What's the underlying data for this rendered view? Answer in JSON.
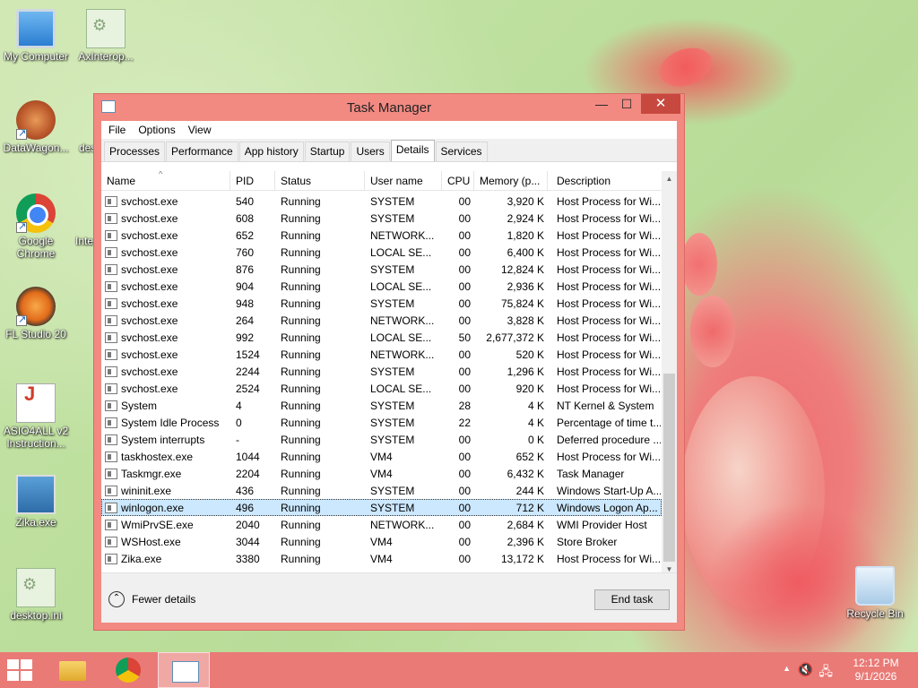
{
  "desktop": {
    "icons": [
      {
        "label": "My Computer"
      },
      {
        "label": "AxInterop..."
      },
      {
        "label": "DataWagon..."
      },
      {
        "label": "des"
      },
      {
        "label": "Google Chrome"
      },
      {
        "label": "Inte"
      },
      {
        "label": "FL Studio 20"
      },
      {
        "label": "ASIO4ALL v2 Instruction..."
      },
      {
        "label": "Zika.exe"
      },
      {
        "label": "desktop.ini"
      },
      {
        "label": "Recycle Bin"
      }
    ]
  },
  "window": {
    "title": "Task Manager",
    "controls": {
      "minimize": "—",
      "maximize": "☐",
      "close": "✕"
    },
    "menu": [
      "File",
      "Options",
      "View"
    ],
    "tabs": [
      "Processes",
      "Performance",
      "App history",
      "Startup",
      "Users",
      "Details",
      "Services"
    ],
    "active_tab": "Details",
    "columns": [
      "Name",
      "PID",
      "Status",
      "User name",
      "CPU",
      "Memory (p...",
      "Description"
    ],
    "rows": [
      {
        "name": "svchost.exe",
        "pid": "540",
        "status": "Running",
        "user": "SYSTEM",
        "cpu": "00",
        "mem": "3,920 K",
        "desc": "Host Process for Wi..."
      },
      {
        "name": "svchost.exe",
        "pid": "608",
        "status": "Running",
        "user": "SYSTEM",
        "cpu": "00",
        "mem": "2,924 K",
        "desc": "Host Process for Wi..."
      },
      {
        "name": "svchost.exe",
        "pid": "652",
        "status": "Running",
        "user": "NETWORK...",
        "cpu": "00",
        "mem": "1,820 K",
        "desc": "Host Process for Wi..."
      },
      {
        "name": "svchost.exe",
        "pid": "760",
        "status": "Running",
        "user": "LOCAL SE...",
        "cpu": "00",
        "mem": "6,400 K",
        "desc": "Host Process for Wi..."
      },
      {
        "name": "svchost.exe",
        "pid": "876",
        "status": "Running",
        "user": "SYSTEM",
        "cpu": "00",
        "mem": "12,824 K",
        "desc": "Host Process for Wi..."
      },
      {
        "name": "svchost.exe",
        "pid": "904",
        "status": "Running",
        "user": "LOCAL SE...",
        "cpu": "00",
        "mem": "2,936 K",
        "desc": "Host Process for Wi..."
      },
      {
        "name": "svchost.exe",
        "pid": "948",
        "status": "Running",
        "user": "SYSTEM",
        "cpu": "00",
        "mem": "75,824 K",
        "desc": "Host Process for Wi..."
      },
      {
        "name": "svchost.exe",
        "pid": "264",
        "status": "Running",
        "user": "NETWORK...",
        "cpu": "00",
        "mem": "3,828 K",
        "desc": "Host Process for Wi..."
      },
      {
        "name": "svchost.exe",
        "pid": "992",
        "status": "Running",
        "user": "LOCAL SE...",
        "cpu": "50",
        "mem": "2,677,372 K",
        "desc": "Host Process for Wi..."
      },
      {
        "name": "svchost.exe",
        "pid": "1524",
        "status": "Running",
        "user": "NETWORK...",
        "cpu": "00",
        "mem": "520 K",
        "desc": "Host Process for Wi..."
      },
      {
        "name": "svchost.exe",
        "pid": "2244",
        "status": "Running",
        "user": "SYSTEM",
        "cpu": "00",
        "mem": "1,296 K",
        "desc": "Host Process for Wi..."
      },
      {
        "name": "svchost.exe",
        "pid": "2524",
        "status": "Running",
        "user": "LOCAL SE...",
        "cpu": "00",
        "mem": "920 K",
        "desc": "Host Process for Wi..."
      },
      {
        "name": "System",
        "pid": "4",
        "status": "Running",
        "user": "SYSTEM",
        "cpu": "28",
        "mem": "4 K",
        "desc": "NT Kernel & System"
      },
      {
        "name": "System Idle Process",
        "pid": "0",
        "status": "Running",
        "user": "SYSTEM",
        "cpu": "22",
        "mem": "4 K",
        "desc": "Percentage of time t..."
      },
      {
        "name": "System interrupts",
        "pid": "-",
        "status": "Running",
        "user": "SYSTEM",
        "cpu": "00",
        "mem": "0 K",
        "desc": "Deferred procedure ..."
      },
      {
        "name": "taskhostex.exe",
        "pid": "1044",
        "status": "Running",
        "user": "VM4",
        "cpu": "00",
        "mem": "652 K",
        "desc": "Host Process for Wi..."
      },
      {
        "name": "Taskmgr.exe",
        "pid": "2204",
        "status": "Running",
        "user": "VM4",
        "cpu": "00",
        "mem": "6,432 K",
        "desc": "Task Manager"
      },
      {
        "name": "wininit.exe",
        "pid": "436",
        "status": "Running",
        "user": "SYSTEM",
        "cpu": "00",
        "mem": "244 K",
        "desc": "Windows Start-Up A..."
      },
      {
        "name": "winlogon.exe",
        "pid": "496",
        "status": "Running",
        "user": "SYSTEM",
        "cpu": "00",
        "mem": "712 K",
        "desc": "Windows Logon Ap...",
        "selected": true
      },
      {
        "name": "WmiPrvSE.exe",
        "pid": "2040",
        "status": "Running",
        "user": "NETWORK...",
        "cpu": "00",
        "mem": "2,684 K",
        "desc": "WMI Provider Host"
      },
      {
        "name": "WSHost.exe",
        "pid": "3044",
        "status": "Running",
        "user": "VM4",
        "cpu": "00",
        "mem": "2,396 K",
        "desc": "Store Broker"
      },
      {
        "name": "Zika.exe",
        "pid": "3380",
        "status": "Running",
        "user": "VM4",
        "cpu": "00",
        "mem": "13,172 K",
        "desc": "Host Process for Wi..."
      }
    ],
    "footer": {
      "fewer_details": "Fewer details",
      "end_task": "End task"
    }
  },
  "taskbar": {
    "clock_time": "12:12 PM",
    "clock_date": "9/1/2026"
  },
  "colors": {
    "accent": "#f28a82",
    "selection": "#cce8ff",
    "taskbar": "#e97a76",
    "close_button": "#c7483e"
  }
}
